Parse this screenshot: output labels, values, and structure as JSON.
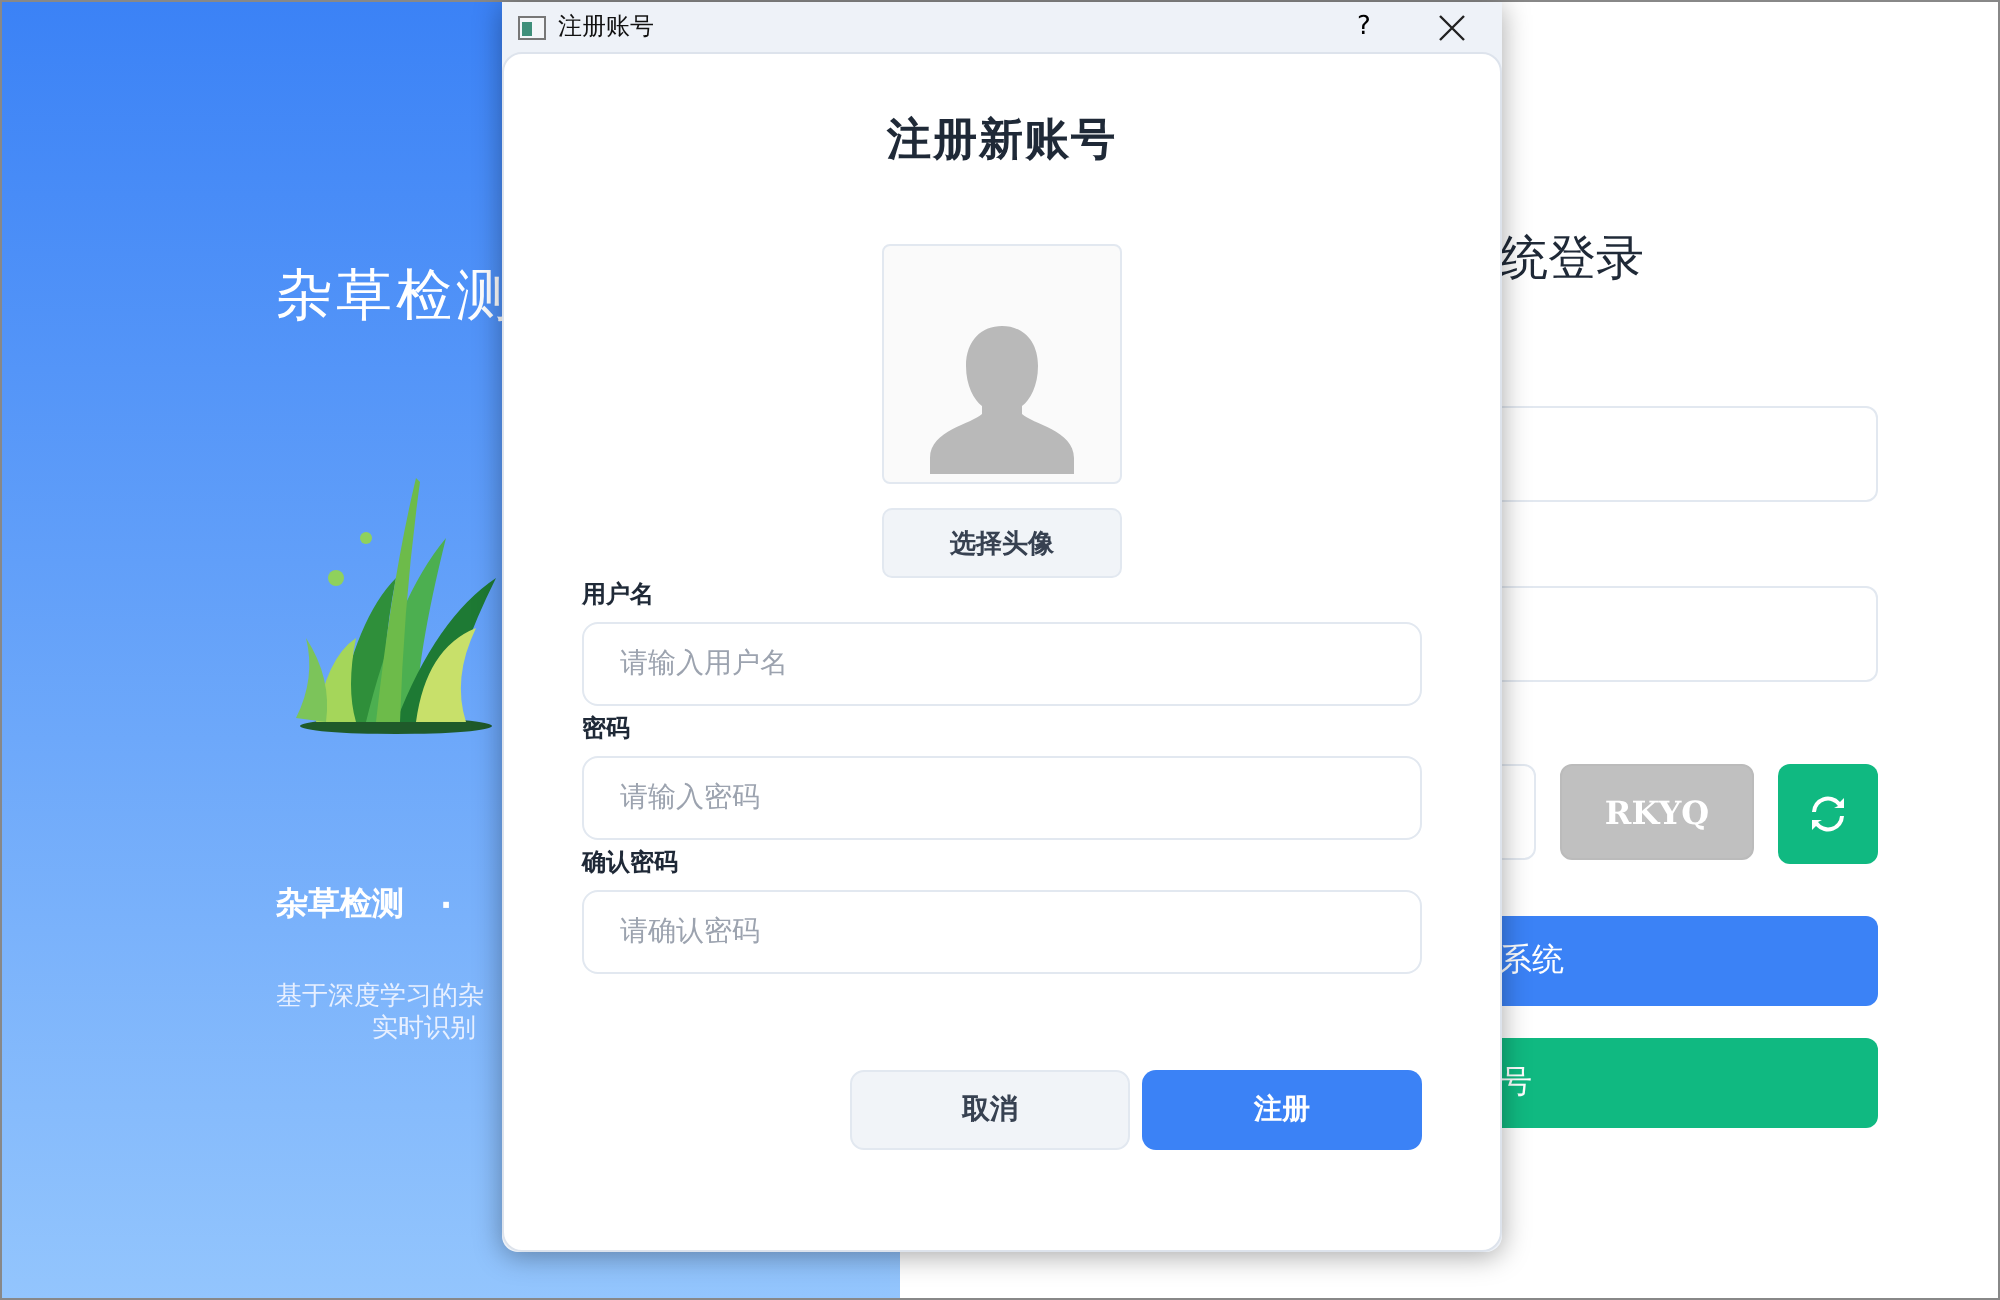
{
  "background_window": {
    "banner": {
      "title": "杂草检测",
      "tagline": [
        "杂草检测",
        "·"
      ],
      "description": [
        "基于深度学习的杂",
        "实时识别"
      ]
    },
    "login": {
      "title": "统登录",
      "captcha_code": "RKYQ",
      "login_button": "系统",
      "register_button": "号"
    }
  },
  "dialog": {
    "title": "注册账号",
    "help_button": "?",
    "heading": "注册新账号",
    "avatar_button": "选择头像",
    "fields": [
      {
        "label": "用户名",
        "placeholder": "请输入用户名"
      },
      {
        "label": "密码",
        "placeholder": "请输入密码"
      },
      {
        "label": "确认密码",
        "placeholder": "请确认密码"
      }
    ],
    "buttons": [
      {
        "label": "取消",
        "kind": "secondary"
      },
      {
        "label": "注册",
        "kind": "primary"
      }
    ]
  }
}
